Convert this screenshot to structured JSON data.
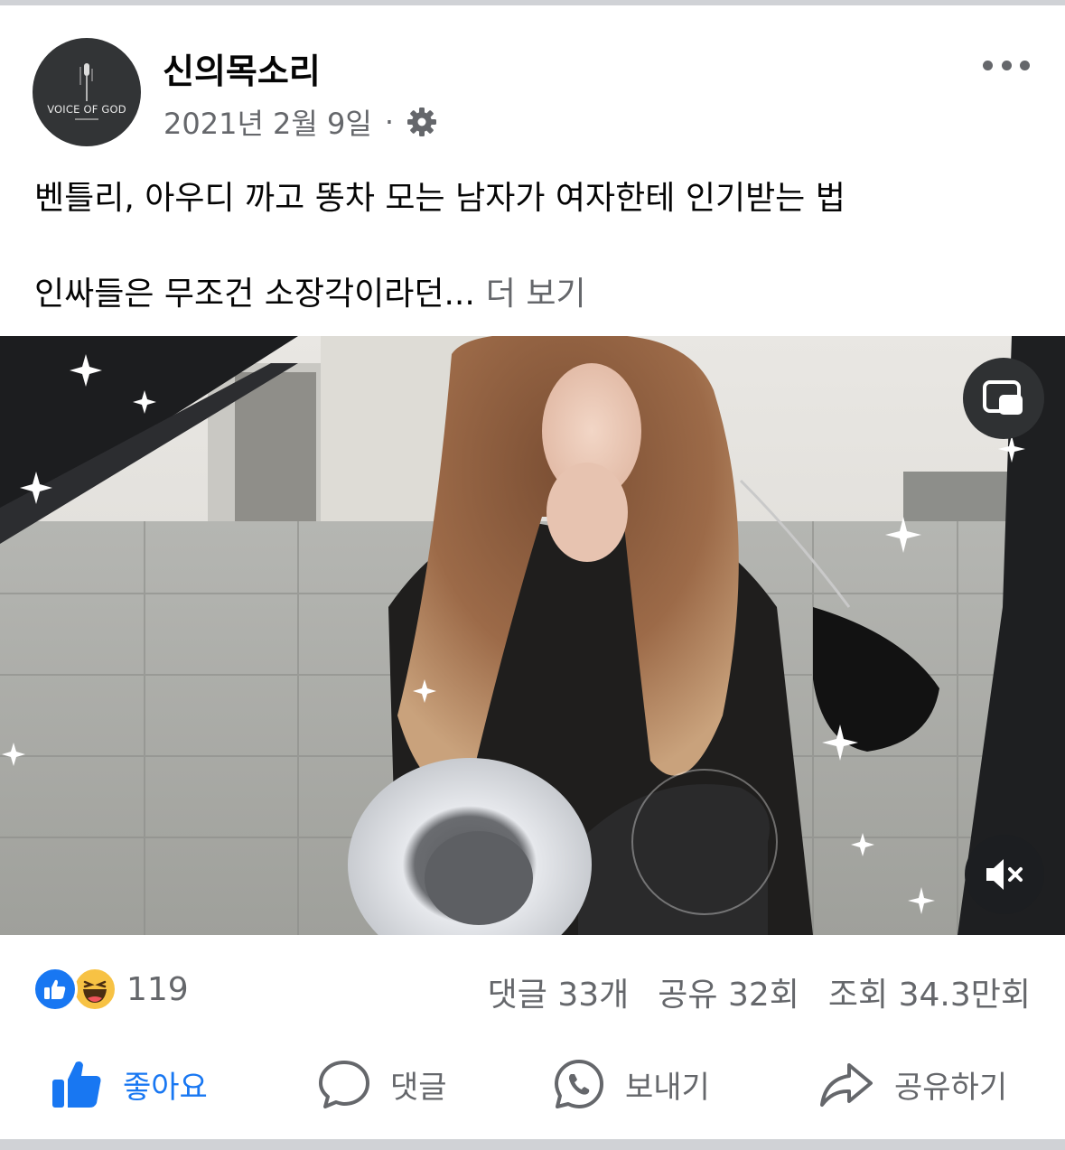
{
  "post": {
    "page_name": "신의목소리",
    "avatar_text": "VOICE OF GOD",
    "date": "2021년 2월 9일",
    "separator": "·",
    "privacy_icon": "gear-icon",
    "more_icon": "more-dots-icon",
    "text_line1": "벤틀리, 아우디 까고 똥차 모는 남자가 여자한테 인기받는 법",
    "text_line2": "인싸들은 무조건 소장각이라던...",
    "see_more": "더 보기"
  },
  "video": {
    "pip_icon": "picture-in-picture-icon",
    "mute_icon": "muted-speaker-icon"
  },
  "stats": {
    "reaction_icons": [
      "like-reaction-icon",
      "haha-reaction-icon"
    ],
    "reaction_count": "119",
    "comments": "댓글 33개",
    "shares": "공유 32회",
    "views": "조회 34.3만회"
  },
  "actions": {
    "like": "좋아요",
    "comment": "댓글",
    "send": "보내기",
    "share": "공유하기"
  },
  "colors": {
    "accent": "#1877f2",
    "secondary_text": "#65676b",
    "haha": "#f7c244"
  }
}
